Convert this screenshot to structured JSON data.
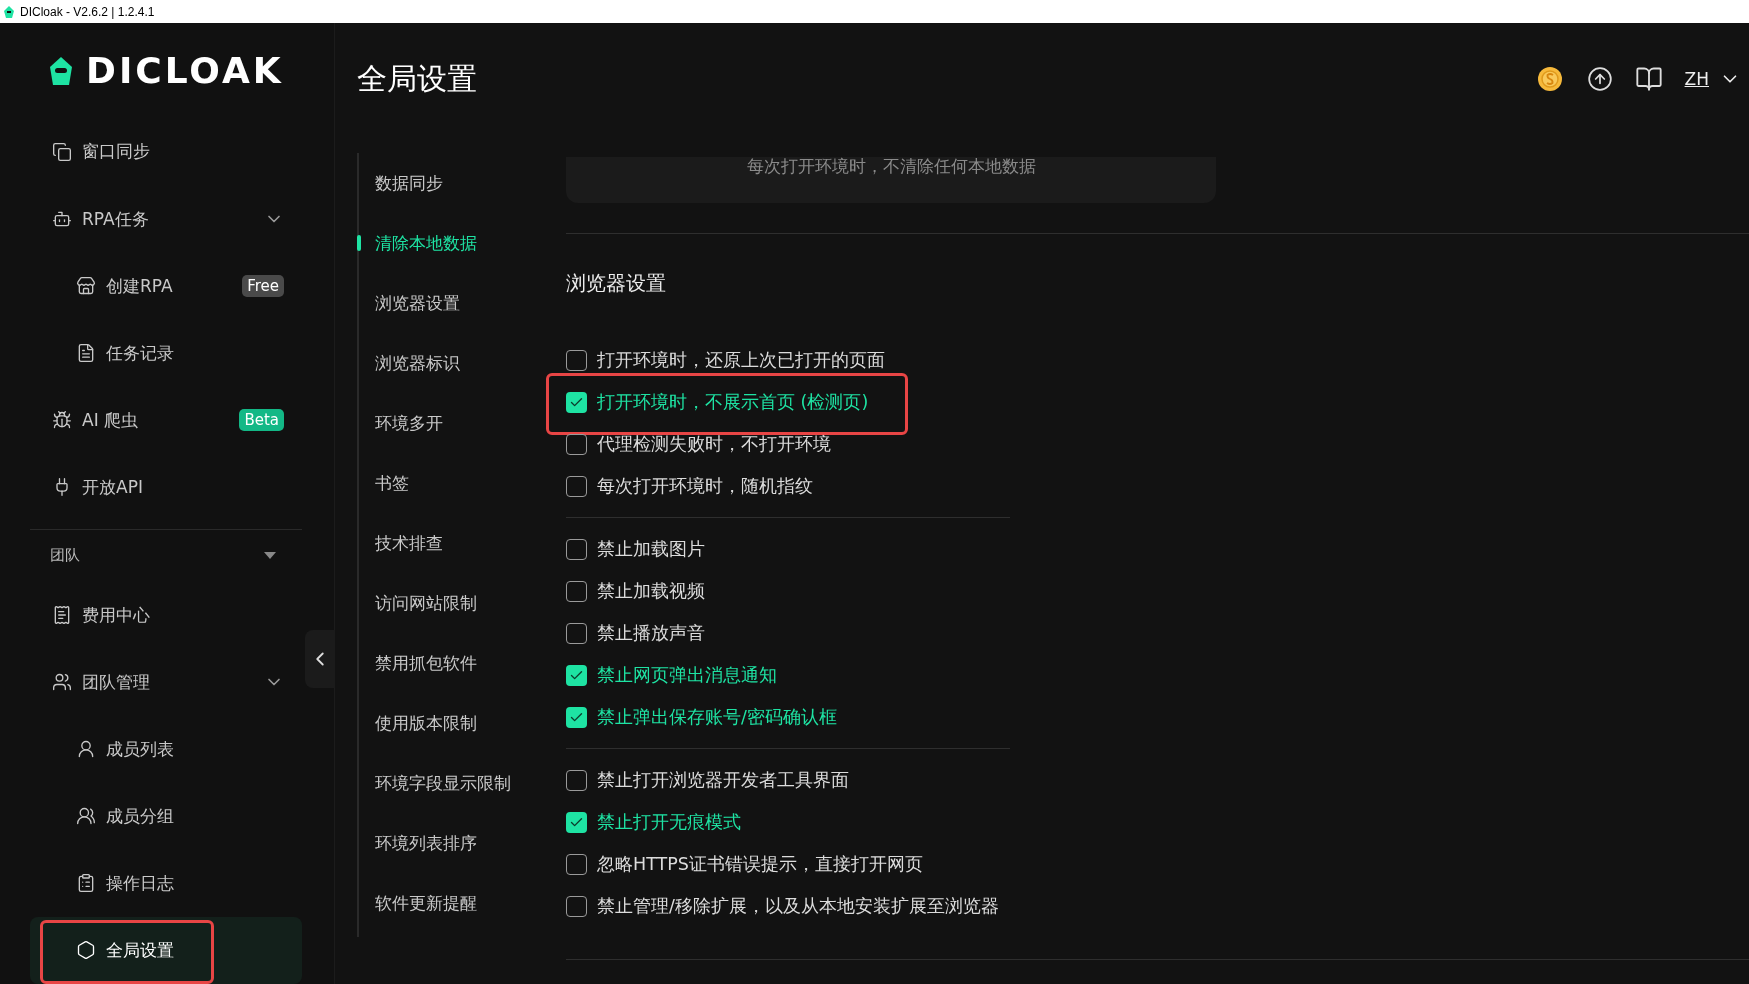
{
  "window": {
    "title": "DICloak - V2.6.2 | 1.2.4.1"
  },
  "logo": {
    "text": "DICLOAK"
  },
  "sidebar": {
    "items": [
      {
        "label": "窗口同步",
        "selected": false,
        "highlighted": false
      },
      {
        "label": "RPA任务",
        "selected": false,
        "highlighted": false,
        "expanded": true,
        "children": [
          {
            "label": "创建RPA",
            "selected": false,
            "highlighted": false,
            "badge": {
              "text": "Free",
              "color": "#4a4a4a"
            }
          },
          {
            "label": "任务记录",
            "selected": false,
            "highlighted": false
          }
        ]
      },
      {
        "label": "AI 爬虫",
        "selected": false,
        "highlighted": false,
        "badge": {
          "text": "Beta",
          "color": "#13b886"
        }
      },
      {
        "label": "开放API",
        "selected": false,
        "highlighted": false
      }
    ],
    "team": {
      "label": "团队",
      "expanded": true,
      "items": [
        {
          "label": "费用中心",
          "selected": false,
          "highlighted": false
        },
        {
          "label": "团队管理",
          "selected": false,
          "highlighted": false,
          "expanded": true,
          "children": [
            {
              "label": "成员列表",
              "selected": false,
              "highlighted": false
            },
            {
              "label": "成员分组",
              "selected": false,
              "highlighted": false
            },
            {
              "label": "操作日志",
              "selected": false,
              "highlighted": false
            },
            {
              "label": "全局设置",
              "selected": true,
              "highlighted": true
            }
          ]
        }
      ]
    }
  },
  "header": {
    "title": "全局设置",
    "language": "ZH"
  },
  "settings_nav": [
    {
      "label": "数据同步",
      "selected": false
    },
    {
      "label": "清除本地数据",
      "selected": true
    },
    {
      "label": "浏览器设置",
      "selected": false
    },
    {
      "label": "浏览器标识",
      "selected": false
    },
    {
      "label": "环境多开",
      "selected": false
    },
    {
      "label": "书签",
      "selected": false
    },
    {
      "label": "技术排查",
      "selected": false
    },
    {
      "label": "访问网站限制",
      "selected": false
    },
    {
      "label": "禁用抓包软件",
      "selected": false
    },
    {
      "label": "使用版本限制",
      "selected": false
    },
    {
      "label": "环境字段显示限制",
      "selected": false
    },
    {
      "label": "环境列表排序",
      "selected": false
    },
    {
      "label": "软件更新提醒",
      "selected": false
    }
  ],
  "clear_data_card": {
    "text": "每次打开环境时，不清除任何本地数据"
  },
  "browser_settings": {
    "title": "浏览器设置",
    "groups": [
      [
        {
          "label": "打开环境时，还原上次已打开的页面",
          "checked": false,
          "highlighted": false
        },
        {
          "label": "打开环境时，不展示首页 (检测页)",
          "checked": true,
          "highlighted": true
        },
        {
          "label": "代理检测失败时，不打开环境",
          "checked": false,
          "highlighted": false
        },
        {
          "label": "每次打开环境时，随机指纹",
          "checked": false,
          "highlighted": false
        }
      ],
      [
        {
          "label": "禁止加载图片",
          "checked": false,
          "highlighted": false
        },
        {
          "label": "禁止加载视频",
          "checked": false,
          "highlighted": false
        },
        {
          "label": "禁止播放声音",
          "checked": false,
          "highlighted": false
        },
        {
          "label": "禁止网页弹出消息通知",
          "checked": true,
          "highlighted": false
        },
        {
          "label": "禁止弹出保存账号/密码确认框",
          "checked": true,
          "highlighted": false
        }
      ],
      [
        {
          "label": "禁止打开浏览器开发者工具界面",
          "checked": false,
          "highlighted": false
        },
        {
          "label": "禁止打开无痕模式",
          "checked": true,
          "highlighted": false
        },
        {
          "label": "忽略HTTPS证书错误提示，直接打开网页",
          "checked": false,
          "highlighted": false
        },
        {
          "label": "禁止管理/移除扩展，以及从本地安装扩展至浏览器",
          "checked": false,
          "highlighted": false
        }
      ]
    ]
  }
}
